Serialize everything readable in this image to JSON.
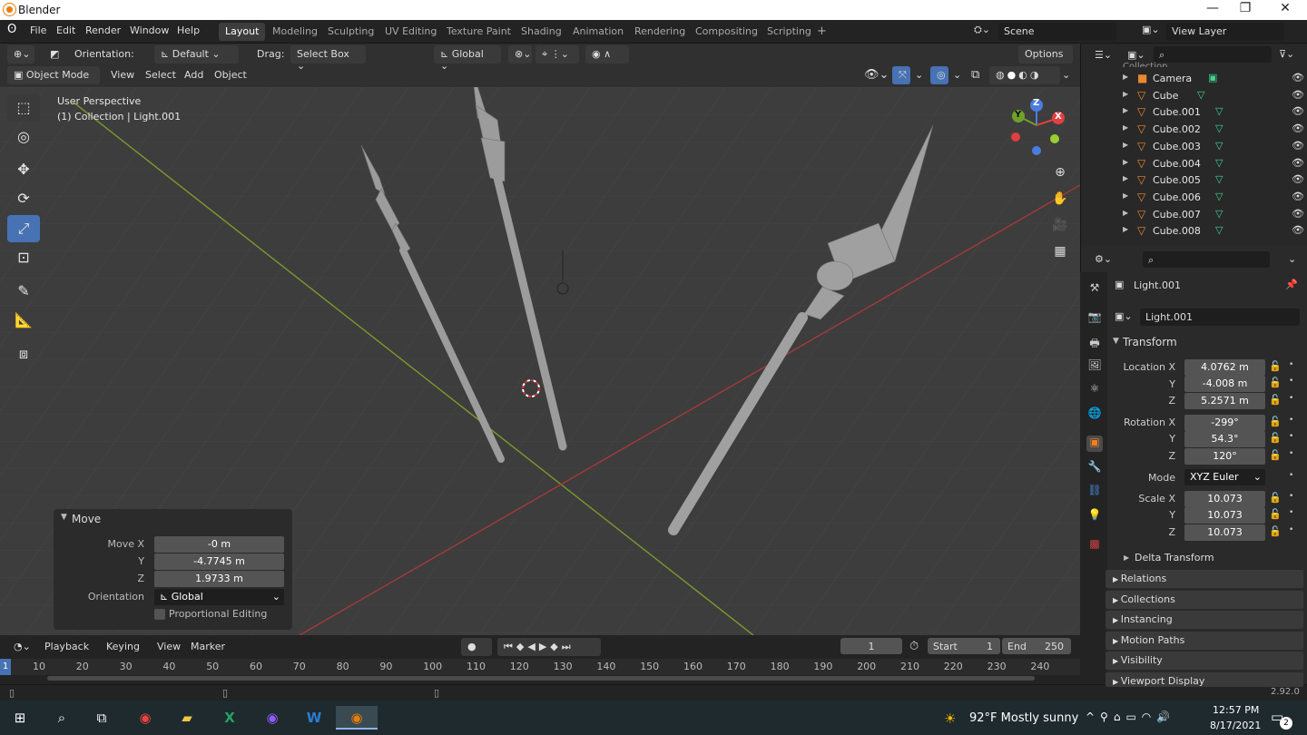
{
  "window": {
    "title": "Blender",
    "min": "—",
    "max": "❐",
    "close": "✕"
  },
  "menus": [
    "File",
    "Edit",
    "Render",
    "Window",
    "Help"
  ],
  "workspaces": [
    "Layout",
    "Modeling",
    "Sculpting",
    "UV Editing",
    "Texture Paint",
    "Shading",
    "Animation",
    "Rendering",
    "Compositing",
    "Scripting"
  ],
  "workspace_add": "+",
  "scene": "Scene",
  "view_layer": "View Layer",
  "toolhdr": {
    "orientation_label": "Orientation:",
    "orientation": "Default",
    "drag_label": "Drag:",
    "drag": "Select Box",
    "transform_orient": "Global",
    "options": "Options"
  },
  "vhdr": {
    "mode": "Object Mode",
    "view": "View",
    "select": "Select",
    "add": "Add",
    "object": "Object"
  },
  "viewport": {
    "persp": "User Perspective",
    "context": "(1) Collection | Light.001"
  },
  "gizmo": {
    "x": "X",
    "y": "Y",
    "z": "Z"
  },
  "move_panel": {
    "title": "Move",
    "move_x_label": "Move X",
    "move_x": "-0 m",
    "y_label": "Y",
    "y": "-4.7745 m",
    "z_label": "Z",
    "z": "1.9733 m",
    "orient_label": "Orientation",
    "orient": "Global",
    "prop_edit": "Proportional Editing"
  },
  "timeline": {
    "playback": "Playback",
    "keying": "Keying",
    "view": "View",
    "marker": "Marker",
    "frame": "1",
    "start_label": "Start",
    "start": "1",
    "end_label": "End",
    "end": "250",
    "ticks": [
      "10",
      "20",
      "30",
      "40",
      "50",
      "60",
      "70",
      "80",
      "90",
      "100",
      "110",
      "120",
      "130",
      "140",
      "150",
      "160",
      "170",
      "180",
      "190",
      "200",
      "210",
      "220",
      "230",
      "240"
    ],
    "current": "1"
  },
  "outliner": {
    "partial": "Collection",
    "items": [
      {
        "name": "Camera",
        "icon": "camera-icon"
      },
      {
        "name": "Cube"
      },
      {
        "name": "Cube.001"
      },
      {
        "name": "Cube.002"
      },
      {
        "name": "Cube.003"
      },
      {
        "name": "Cube.004"
      },
      {
        "name": "Cube.005"
      },
      {
        "name": "Cube.006"
      },
      {
        "name": "Cube.007"
      },
      {
        "name": "Cube.008"
      }
    ]
  },
  "props": {
    "object": "Light.001",
    "datablock": "Light.001",
    "transform": "Transform",
    "loc_label": "Location X",
    "loc": [
      "4.0762 m",
      "-4.008 m",
      "5.2571 m"
    ],
    "rot_label": "Rotation X",
    "rot": [
      "-299°",
      "54.3°",
      "120°"
    ],
    "mode_label": "Mode",
    "mode": "XYZ Euler",
    "scale_label": "Scale X",
    "scale": [
      "10.073",
      "10.073",
      "10.073"
    ],
    "y": "Y",
    "z": "Z",
    "delta": "Delta Transform",
    "sections": [
      "Relations",
      "Collections",
      "Instancing",
      "Motion Paths",
      "Visibility",
      "Viewport Display"
    ]
  },
  "status": {
    "version": "2.92.0"
  },
  "taskbar": {
    "weather": "92°F  Mostly sunny",
    "time": "12:57 PM",
    "date": "8/17/2021",
    "notif": "2"
  }
}
